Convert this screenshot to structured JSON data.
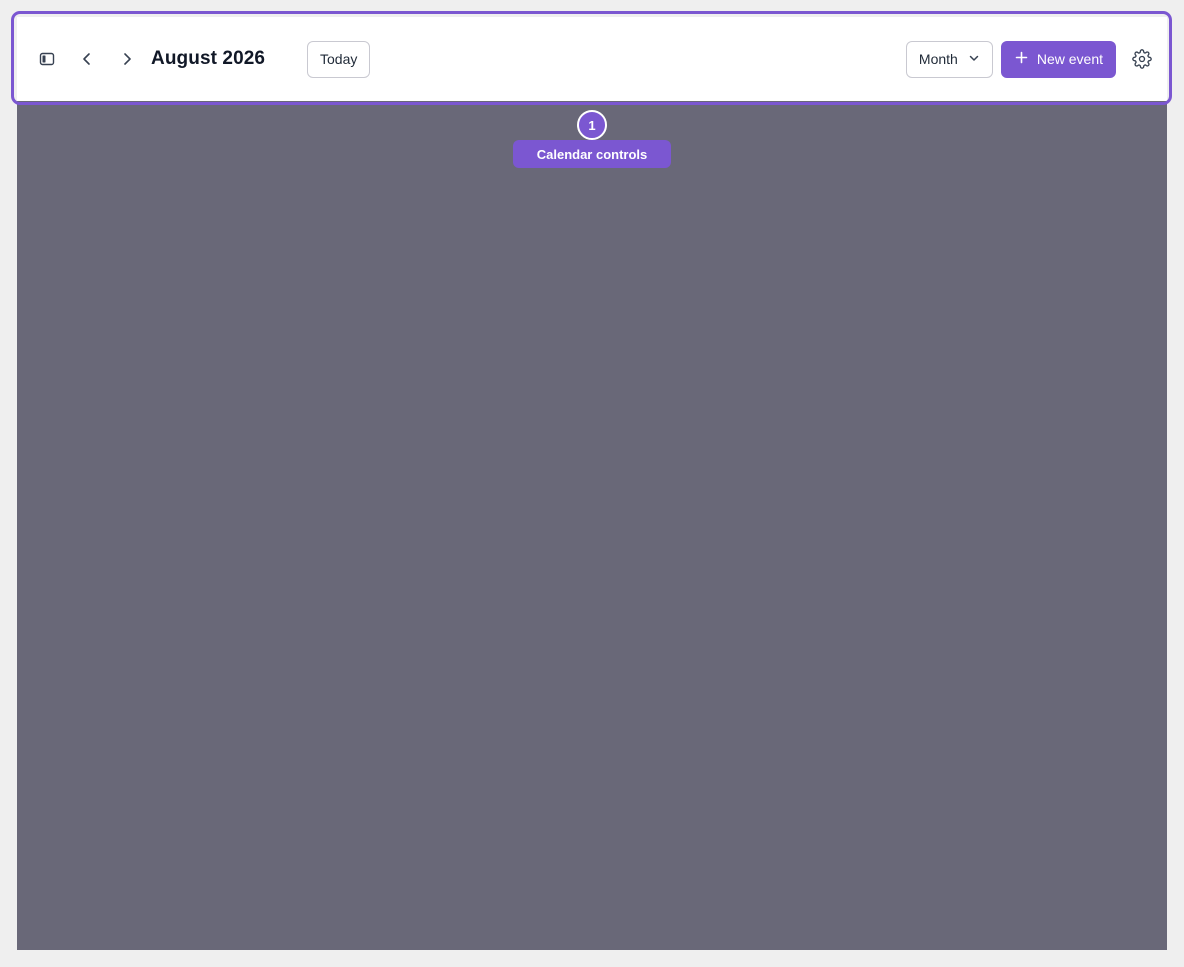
{
  "header": {
    "title": "August 2026",
    "today_label": "Today",
    "view_select_value": "Month",
    "new_event_label": "New event"
  },
  "icons": {
    "sidebar_toggle": "sidebar-panel-icon",
    "prev": "chevron-left-icon",
    "next": "chevron-right-icon",
    "view_dropdown": "chevron-down-icon",
    "new_event": "plus-icon",
    "settings": "gear-icon"
  },
  "callout": {
    "number": "1",
    "label": "Calendar controls"
  },
  "colors": {
    "accent": "#7b57d1",
    "overlay": "#696878",
    "page_background": "#efefef"
  }
}
